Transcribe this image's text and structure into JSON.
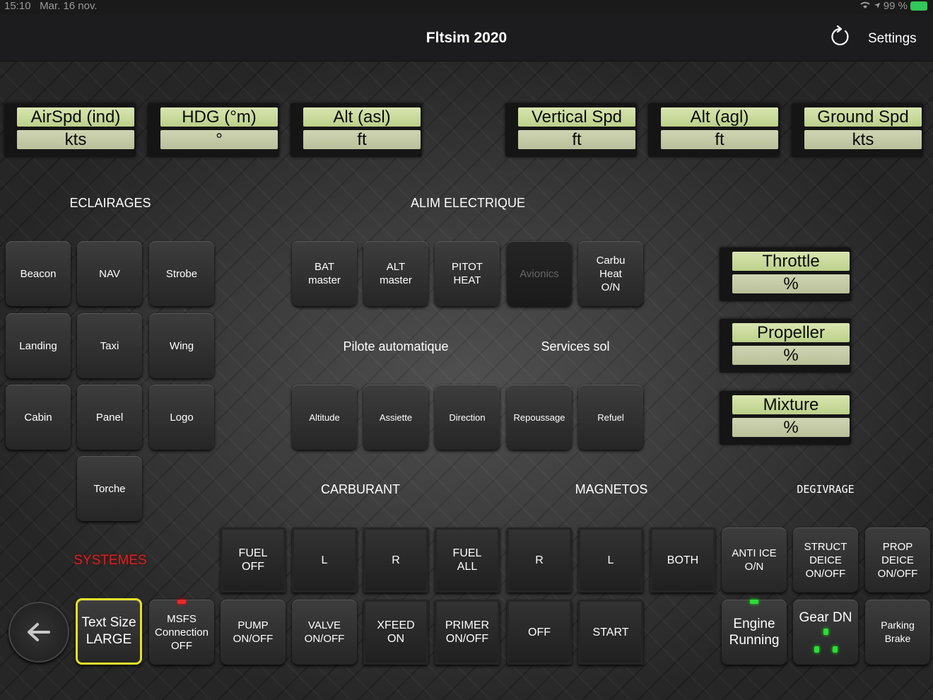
{
  "statusbar": {
    "time": "15:10",
    "date": "Mar. 16 nov.",
    "battery": "99 %"
  },
  "navbar": {
    "title": "Fltsim 2020",
    "settings": "Settings"
  },
  "gauges": [
    {
      "label": "AirSpd (ind)",
      "unit": "kts"
    },
    {
      "label": "HDG (°m)",
      "unit": "°"
    },
    {
      "label": "Alt (asl)",
      "unit": "ft"
    },
    {
      "label": "Vertical Spd",
      "unit": "ft"
    },
    {
      "label": "Alt (agl)",
      "unit": "ft"
    },
    {
      "label": "Ground Spd",
      "unit": "kts"
    }
  ],
  "side_gauges": [
    {
      "label": "Throttle",
      "unit": "%"
    },
    {
      "label": "Propeller",
      "unit": "%"
    },
    {
      "label": "Mixture",
      "unit": "%"
    }
  ],
  "sections": {
    "eclairages": "ECLAIRAGES",
    "alim": "ALIM ELECTRIQUE",
    "pilote": "Pilote automatique",
    "services": "Services sol",
    "carburant": "CARBURANT",
    "magnetos": "MAGNETOS",
    "degivrage": "DEGIVRAGE",
    "systemes": "SYSTEMES"
  },
  "lights": {
    "beacon": "Beacon",
    "nav": "NAV",
    "strobe": "Strobe",
    "landing": "Landing",
    "taxi": "Taxi",
    "wing": "Wing",
    "cabin": "Cabin",
    "panel": "Panel",
    "logo": "Logo",
    "torche": "Torche"
  },
  "electric": {
    "bat": "BAT\nmaster",
    "alt": "ALT\nmaster",
    "pitot": "PITOT\nHEAT",
    "avionics": "Avionics",
    "carbu": "Carbu\nHeat\nO/N"
  },
  "autopilot": {
    "altitude": "Altitude",
    "assiette": "Assiette",
    "direction": "Direction"
  },
  "ground": {
    "repoussage": "Repoussage",
    "refuel": "Refuel"
  },
  "fuel": {
    "off": "FUEL\nOFF",
    "l": "L",
    "r": "R",
    "all": "FUEL\nALL",
    "pump": "PUMP\nON/OFF",
    "valve": "VALVE\nON/OFF",
    "xfeed": "XFEED\nON",
    "primer": "PRIMER\nON/OFF"
  },
  "magnetos": {
    "r": "R",
    "l": "L",
    "both": "BOTH",
    "off": "OFF",
    "start": "START"
  },
  "deice": {
    "anti": "ANTI ICE\nO/N",
    "struct": "STRUCT\nDEICE\nON/OFF",
    "prop": "PROP\nDEICE\nON/OFF"
  },
  "systems": {
    "textsize": "Text Size\nLARGE",
    "msfs": "MSFS\nConnection\nOFF",
    "engine": "Engine\nRunning",
    "gear": "Gear DN",
    "parking": "Parking\nBrake"
  }
}
